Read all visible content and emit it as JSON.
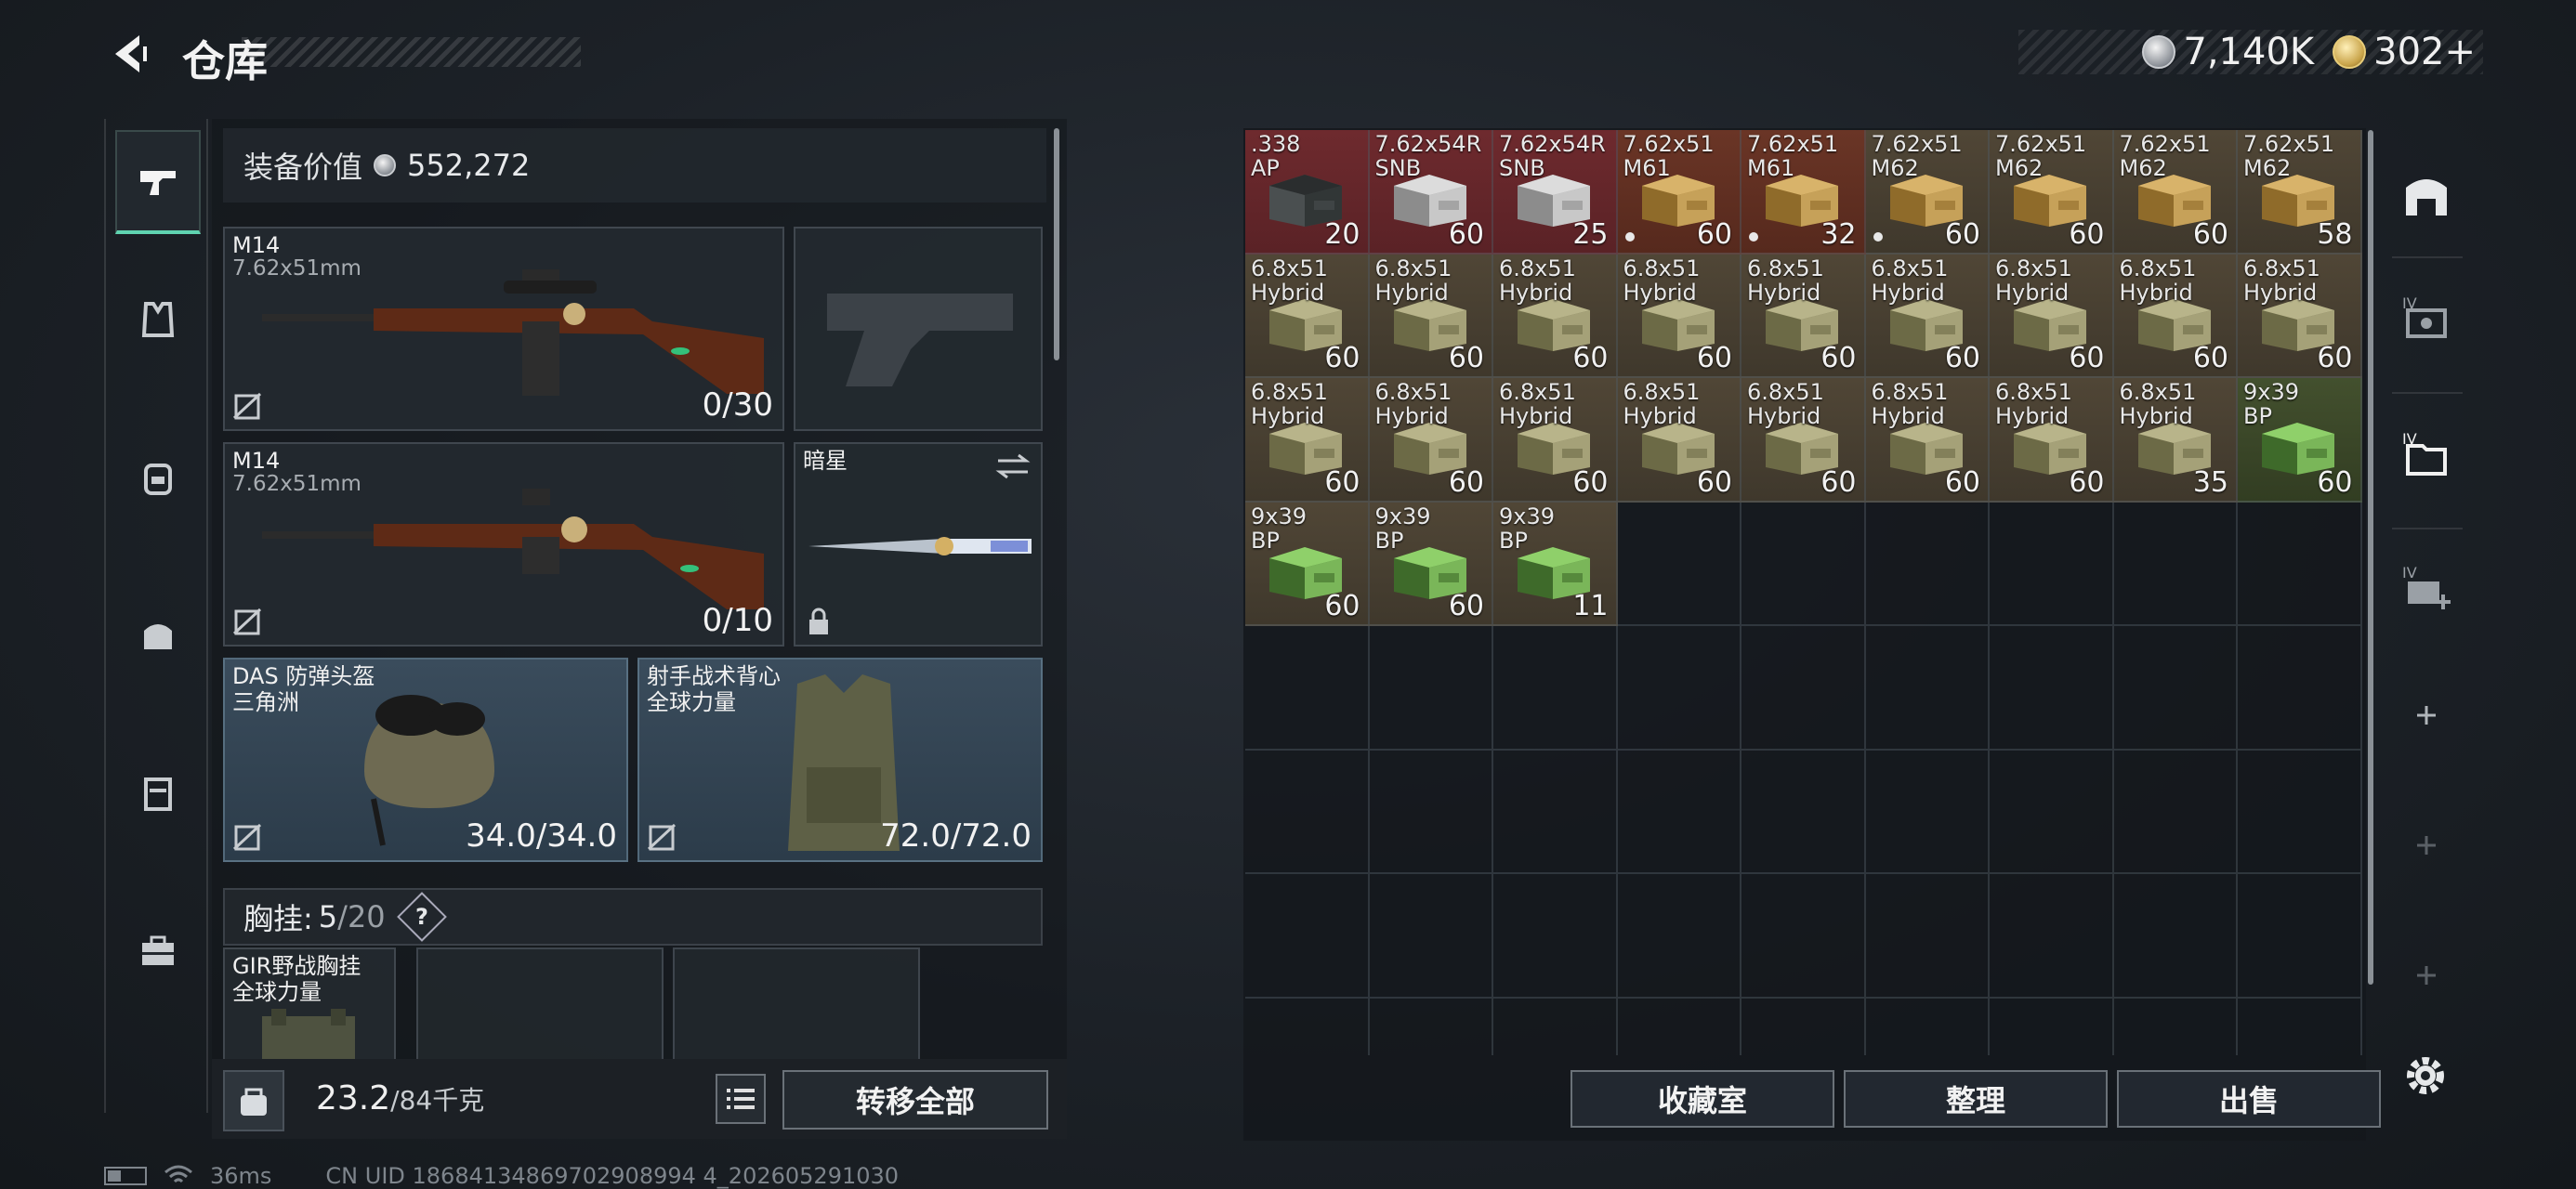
{
  "header": {
    "title": "仓库"
  },
  "currency": {
    "silver": "7,140K",
    "gold": "302+"
  },
  "equip_value": {
    "label": "装备价值",
    "value": "552,272"
  },
  "slots": {
    "primary1": {
      "name": "M14",
      "caliber": "7.62x51mm",
      "ammo": "0/30"
    },
    "primary2": {
      "name": "M14",
      "caliber": "7.62x51mm",
      "ammo": "0/10"
    },
    "melee": {
      "name": "暗星"
    },
    "helmet": {
      "name": "DAS 防弹头盔",
      "brand": "三角洲",
      "durability": "34.0/34.0"
    },
    "armor": {
      "name": "射手战术背心",
      "brand": "全球力量",
      "durability": "72.0/72.0"
    },
    "rig": {
      "name": "GIR野战胸挂",
      "brand": "全球力量"
    }
  },
  "chest_rig": {
    "label": "胸挂:",
    "count": "5",
    "max": "/20",
    "help": "?"
  },
  "weight": {
    "current": "23.2",
    "max": "/84千克"
  },
  "buttons": {
    "transfer_all": "转移全部",
    "collection": "收藏室",
    "organize": "整理",
    "sell": "出售"
  },
  "storage_items": [
    {
      "line1": ".338",
      "line2": "AP",
      "count": "20",
      "bg": "bg-red",
      "box": "dark",
      "dot": false
    },
    {
      "line1": "7.62x54R",
      "line2": "SNB",
      "count": "60",
      "bg": "bg-red",
      "box": "white",
      "dot": false
    },
    {
      "line1": "7.62x54R",
      "line2": "SNB",
      "count": "25",
      "bg": "bg-red",
      "box": "white",
      "dot": false
    },
    {
      "line1": "7.62x51",
      "line2": "M61",
      "count": "60",
      "bg": "bg-orange",
      "box": "tan",
      "dot": true
    },
    {
      "line1": "7.62x51",
      "line2": "M61",
      "count": "32",
      "bg": "bg-orange",
      "box": "tan",
      "dot": true
    },
    {
      "line1": "7.62x51",
      "line2": "M62",
      "count": "60",
      "bg": "bg-brown",
      "box": "tan",
      "dot": true
    },
    {
      "line1": "7.62x51",
      "line2": "M62",
      "count": "60",
      "bg": "bg-brown",
      "box": "tan",
      "dot": false
    },
    {
      "line1": "7.62x51",
      "line2": "M62",
      "count": "60",
      "bg": "bg-brown",
      "box": "tan",
      "dot": false
    },
    {
      "line1": "7.62x51",
      "line2": "M62",
      "count": "58",
      "bg": "bg-brown",
      "box": "tan",
      "dot": false
    },
    {
      "line1": "6.8x51",
      "line2": "Hybrid",
      "count": "60",
      "bg": "bg-brown",
      "box": "olive",
      "dot": false
    },
    {
      "line1": "6.8x51",
      "line2": "Hybrid",
      "count": "60",
      "bg": "bg-brown",
      "box": "olive",
      "dot": false
    },
    {
      "line1": "6.8x51",
      "line2": "Hybrid",
      "count": "60",
      "bg": "bg-brown",
      "box": "olive",
      "dot": false
    },
    {
      "line1": "6.8x51",
      "line2": "Hybrid",
      "count": "60",
      "bg": "bg-brown",
      "box": "olive",
      "dot": false
    },
    {
      "line1": "6.8x51",
      "line2": "Hybrid",
      "count": "60",
      "bg": "bg-brown",
      "box": "olive",
      "dot": false
    },
    {
      "line1": "6.8x51",
      "line2": "Hybrid",
      "count": "60",
      "bg": "bg-brown",
      "box": "olive",
      "dot": false
    },
    {
      "line1": "6.8x51",
      "line2": "Hybrid",
      "count": "60",
      "bg": "bg-brown",
      "box": "olive",
      "dot": false
    },
    {
      "line1": "6.8x51",
      "line2": "Hybrid",
      "count": "60",
      "bg": "bg-brown",
      "box": "olive",
      "dot": false
    },
    {
      "line1": "6.8x51",
      "line2": "Hybrid",
      "count": "60",
      "bg": "bg-brown",
      "box": "olive",
      "dot": false
    },
    {
      "line1": "6.8x51",
      "line2": "Hybrid",
      "count": "60",
      "bg": "bg-brown",
      "box": "olive",
      "dot": false
    },
    {
      "line1": "6.8x51",
      "line2": "Hybrid",
      "count": "60",
      "bg": "bg-brown",
      "box": "olive",
      "dot": false
    },
    {
      "line1": "6.8x51",
      "line2": "Hybrid",
      "count": "60",
      "bg": "bg-brown",
      "box": "olive",
      "dot": false
    },
    {
      "line1": "6.8x51",
      "line2": "Hybrid",
      "count": "60",
      "bg": "bg-brown",
      "box": "olive",
      "dot": false
    },
    {
      "line1": "6.8x51",
      "line2": "Hybrid",
      "count": "60",
      "bg": "bg-brown",
      "box": "olive",
      "dot": false
    },
    {
      "line1": "6.8x51",
      "line2": "Hybrid",
      "count": "60",
      "bg": "bg-brown",
      "box": "olive",
      "dot": false
    },
    {
      "line1": "6.8x51",
      "line2": "Hybrid",
      "count": "60",
      "bg": "bg-brown",
      "box": "olive",
      "dot": false
    },
    {
      "line1": "6.8x51",
      "line2": "Hybrid",
      "count": "35",
      "bg": "bg-brown",
      "box": "olive",
      "dot": false
    },
    {
      "line1": "9x39",
      "line2": "BP",
      "count": "60",
      "bg": "bg-green",
      "box": "green",
      "dot": false
    },
    {
      "line1": "9x39",
      "line2": "BP",
      "count": "60",
      "bg": "bg-brown",
      "box": "green",
      "dot": false
    },
    {
      "line1": "9x39",
      "line2": "BP",
      "count": "60",
      "bg": "bg-brown",
      "box": "green",
      "dot": false
    },
    {
      "line1": "9x39",
      "line2": "BP",
      "count": "11",
      "bg": "bg-brown",
      "box": "green",
      "dot": false
    }
  ],
  "status": {
    "ping": "36ms",
    "uid": "CN UID 18684134869702908994 4_202605291030"
  }
}
